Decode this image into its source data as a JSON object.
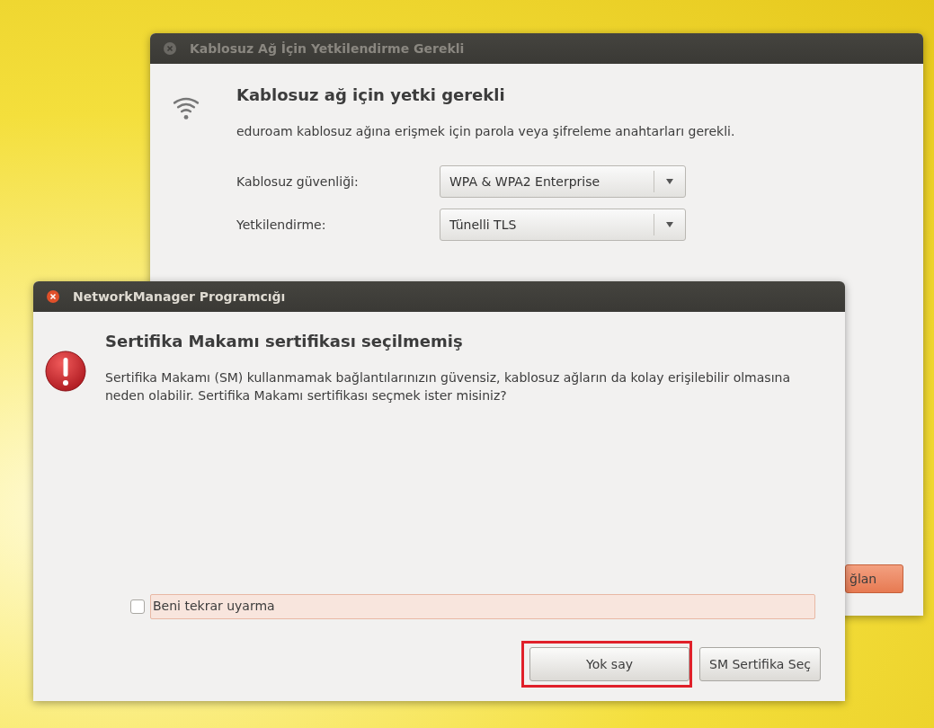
{
  "auth_window": {
    "title": "Kablosuz Ağ İçin Yetkilendirme Gerekli",
    "active": false,
    "heading": "Kablosuz ağ için yetki gerekli",
    "message": "eduroam kablosuz ağına erişmek için parola veya şifreleme anahtarları gerekli.",
    "fields": [
      {
        "label": "Kablosuz güvenliği:",
        "value": "WPA & WPA2 Enterprise"
      },
      {
        "label": "Yetkilendirme:",
        "value": "Tünelli TLS"
      }
    ],
    "button_fragment": "ğlan"
  },
  "alert_window": {
    "title": "NetworkManager Programcığı",
    "active": true,
    "heading": "Sertifika Makamı sertifikası seçilmemiş",
    "message": "Sertifika Makamı (SM) kullanmamak bağlantılarınızın güvensiz, kablosuz ağların da kolay erişilebilir olmasına neden olabilir. Sertifika Makamı sertifikası seçmek ister misiniz?",
    "checkbox": {
      "label": "Beni tekrar uyarma",
      "checked": false
    },
    "buttons": [
      {
        "label": "Yok say",
        "highlighted": true
      },
      {
        "label": "SM Sertifika Seç",
        "highlighted": false
      }
    ]
  }
}
